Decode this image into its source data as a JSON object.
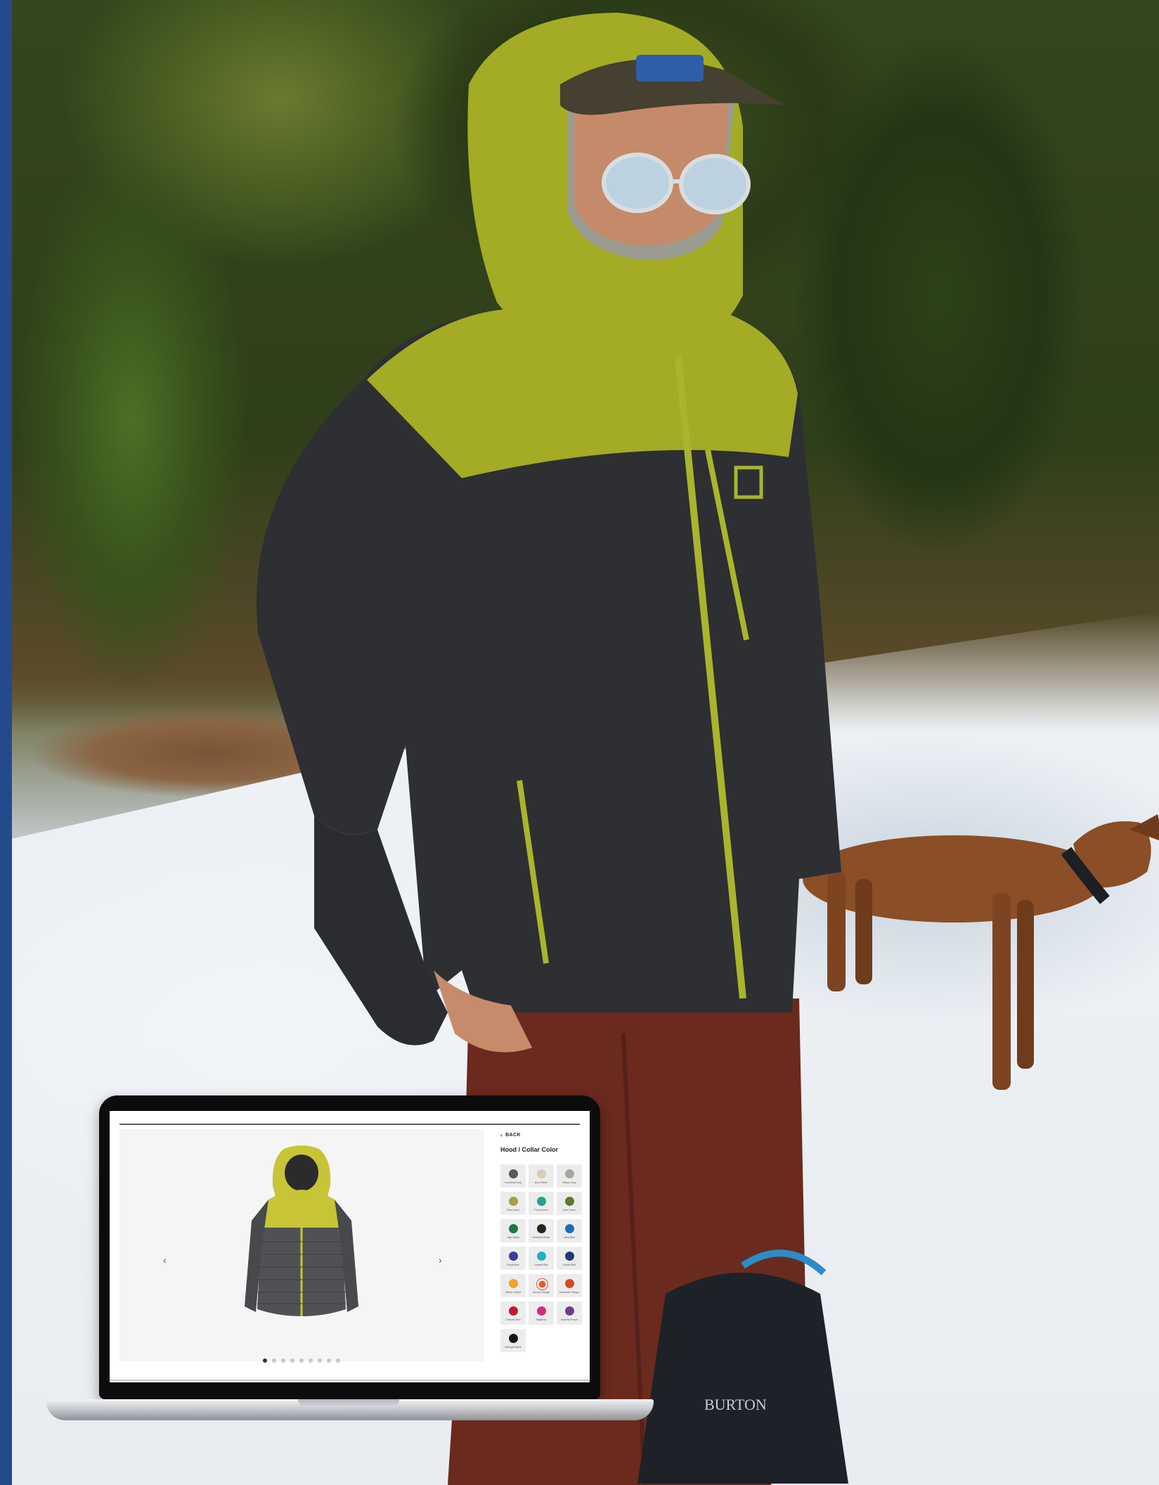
{
  "panel": {
    "back_label": "BACK",
    "title": "Hood / Collar Color"
  },
  "carousel": {
    "prev_icon": "chevron-left-icon",
    "next_icon": "chevron-right-icon",
    "slide_count": 9,
    "active_slide": 1
  },
  "swatches": [
    {
      "name": "Gunmetal Gray",
      "color": "#59595b"
    },
    {
      "name": "Birch White",
      "color": "#d9cdb4"
    },
    {
      "name": "Willow Gray",
      "color": "#a3aa9a"
    },
    {
      "name": "Pear Green",
      "color": "#a6a23a"
    },
    {
      "name": "Pond Green",
      "color": "#1fa58b"
    },
    {
      "name": "Kale Green",
      "color": "#5e7a2a"
    },
    {
      "name": "Jolly Green",
      "color": "#1c7a3d"
    },
    {
      "name": "Hemlock Green",
      "color": "#1f2c1b"
    },
    {
      "name": "Ultra Blue",
      "color": "#1b6fb7"
    },
    {
      "name": "Royal Blue",
      "color": "#3a3d9a"
    },
    {
      "name": "Coastal Blue",
      "color": "#1fb2c4"
    },
    {
      "name": "Cobalt Blue",
      "color": "#1e3d6e"
    },
    {
      "name": "Saffron Yellow",
      "color": "#f2a12a"
    },
    {
      "name": "Sunset Orange",
      "color": "#e85a2b",
      "selected": true
    },
    {
      "name": "Dynamite Orange",
      "color": "#d9482a"
    },
    {
      "name": "Crimson Red",
      "color": "#c4172c"
    },
    {
      "name": "Magenta",
      "color": "#d52b7f"
    },
    {
      "name": "Imperial Purple",
      "color": "#6e3a95"
    },
    {
      "name": "Midnight Black",
      "color": "#151515"
    }
  ]
}
